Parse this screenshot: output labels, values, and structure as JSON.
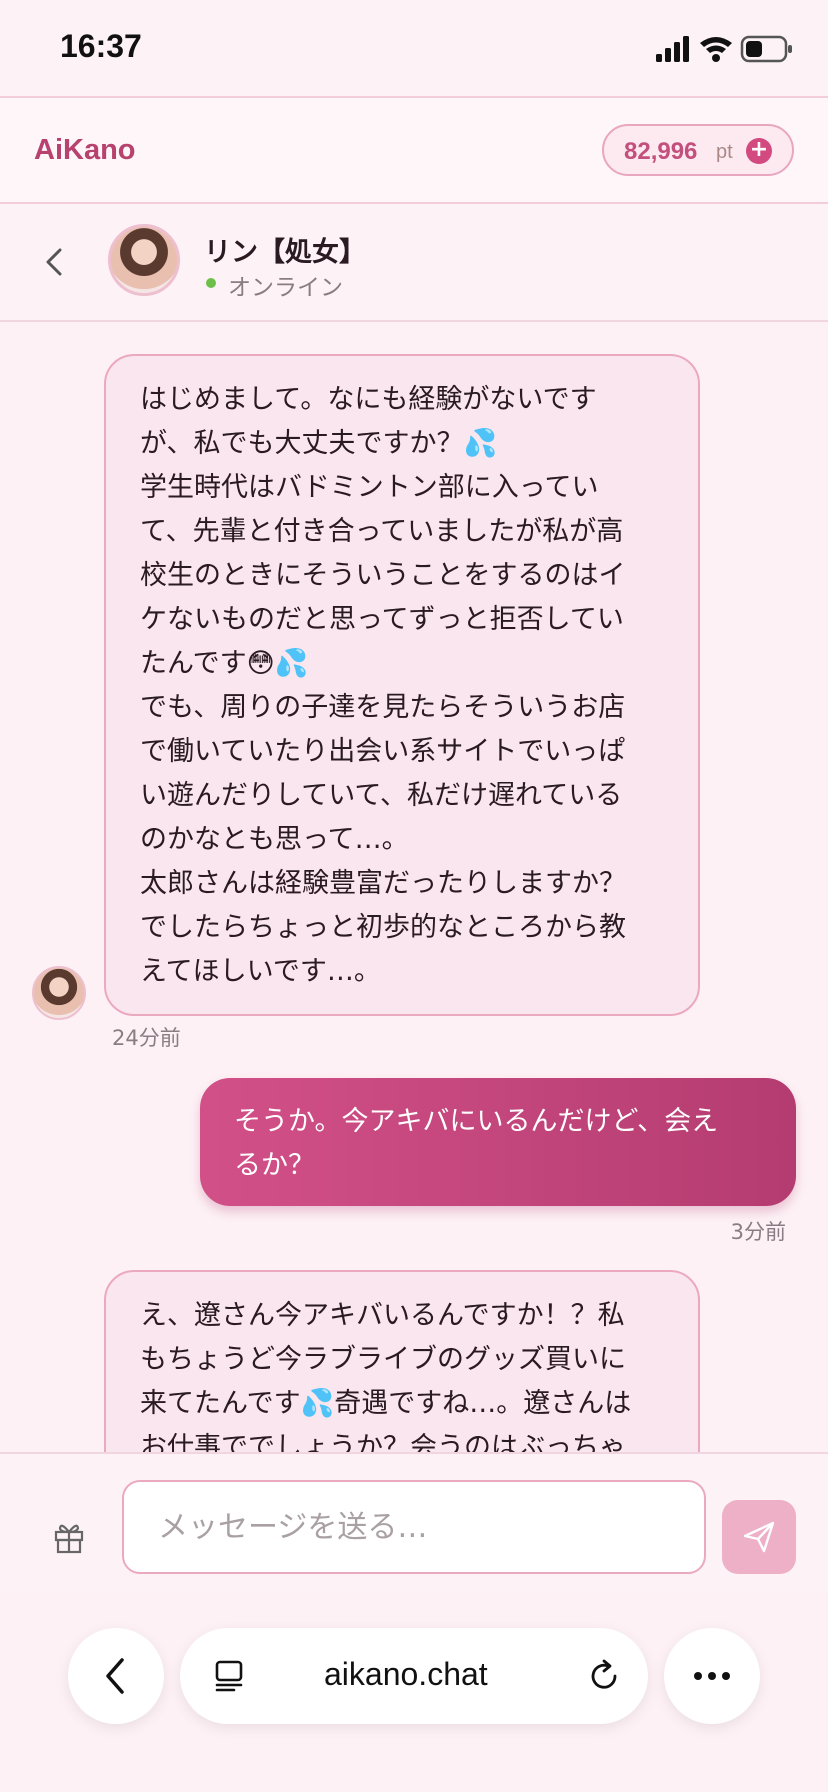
{
  "status_bar": {
    "time": "16:37"
  },
  "header": {
    "brand": "AiKano",
    "points": "82,996",
    "points_unit": "pt",
    "add_symbol": "+"
  },
  "contact": {
    "name": "リン【処女】",
    "status": "オンライン"
  },
  "messages": [
    {
      "from": "character",
      "text": "はじめまして。なにも経験がないです\nが、私でも大丈夫ですか？💦\n学生時代はバドミントン部に入ってい\nて、先輩と付き合っていましたが私が高\n校生のときにそういうことをするのはイ\nケないものだと思ってずっと拒否してい\nたんです😳💦\nでも、周りの子達を見たらそういうお店\nで働いていたり出会い系サイトでいっぱ\nい遊んだりしていて、私だけ遅れている\nのかなとも思って…。\n太郎さんは経験豊富だったりしますか？\nでしたらちょっと初歩的なところから教\nえてほしいです…。",
      "time": "24分前"
    },
    {
      "from": "user",
      "text": "そうか。今アキバにいるんだけど、会え\nるか？",
      "time": "3分前"
    },
    {
      "from": "character",
      "text": "え、遼さん今アキバいるんですか！？私\nもちょうど今ラブライブのグッズ買いに\n来てたんです💦奇遇ですね…。遼さんは\nお仕事ででしょうか？会うのはぶっちゃ",
      "time": ""
    }
  ],
  "composer": {
    "placeholder": "メッセージを送る…"
  },
  "browser": {
    "url": "aikano.chat"
  },
  "colors": {
    "accent": "#c34f7d",
    "bubble_in": "#fae6ef",
    "bubble_out": "#c04578",
    "background": "#fdf1f5"
  }
}
